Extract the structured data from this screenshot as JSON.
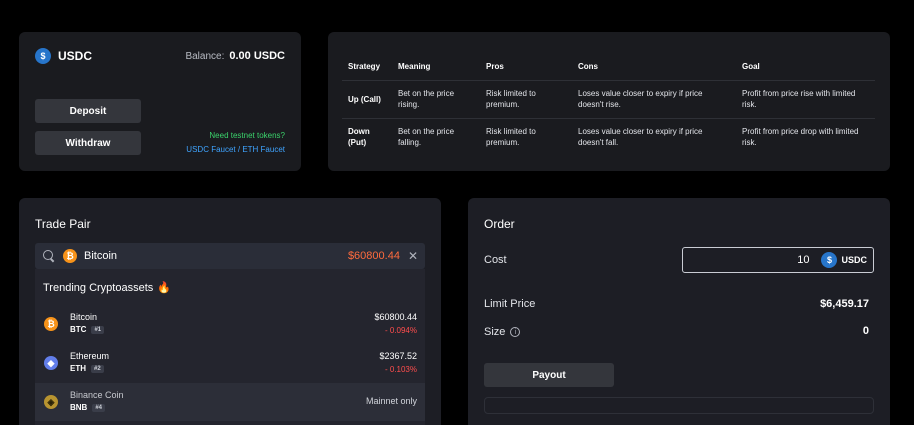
{
  "balance_panel": {
    "coin": "USDC",
    "balance_label": "Balance:",
    "balance_value": "0.00 USDC",
    "deposit_label": "Deposit",
    "withdraw_label": "Withdraw",
    "need_tokens": "Need testnet tokens?",
    "faucet_links": "USDC Faucet / ETH Faucet"
  },
  "strategy_table": {
    "headers": [
      "Strategy",
      "Meaning",
      "Pros",
      "Cons",
      "Goal"
    ],
    "rows": [
      {
        "strategy": "Up (Call)",
        "meaning": "Bet on the price rising.",
        "pros": "Risk limited to premium.",
        "cons": "Loses value closer to expiry if price doesn't rise.",
        "goal": "Profit from price rise with limited risk."
      },
      {
        "strategy": "Down (Put)",
        "meaning": "Bet on the price falling.",
        "pros": "Risk limited to premium.",
        "cons": "Loses value closer to expiry if price doesn't fall.",
        "goal": "Profit from price drop with limited risk."
      }
    ]
  },
  "trade_pair": {
    "title": "Trade Pair",
    "search_value": "Bitcoin",
    "search_price": "$60800.44",
    "trending_label": "Trending Cryptoassets",
    "assets": [
      {
        "name": "Bitcoin",
        "symbol": "BTC",
        "rank": "#1",
        "price": "$60800.44",
        "change": "- 0.094%",
        "logo": "₿",
        "color": "#f7931a"
      },
      {
        "name": "Ethereum",
        "symbol": "ETH",
        "rank": "#2",
        "price": "$2367.52",
        "change": "- 0.103%",
        "logo": "◆",
        "color": "#627eea"
      },
      {
        "name": "Binance Coin",
        "symbol": "BNB",
        "rank": "#4",
        "status": "Mainnet only",
        "logo": "◈",
        "color": "#b89430"
      }
    ]
  },
  "order": {
    "title": "Order",
    "cost_label": "Cost",
    "cost_value": "10",
    "cost_unit": "USDC",
    "limit_price_label": "Limit Price",
    "limit_price_value": "$6,459.17",
    "size_label": "Size",
    "size_value": "0",
    "payout_label": "Payout"
  }
}
